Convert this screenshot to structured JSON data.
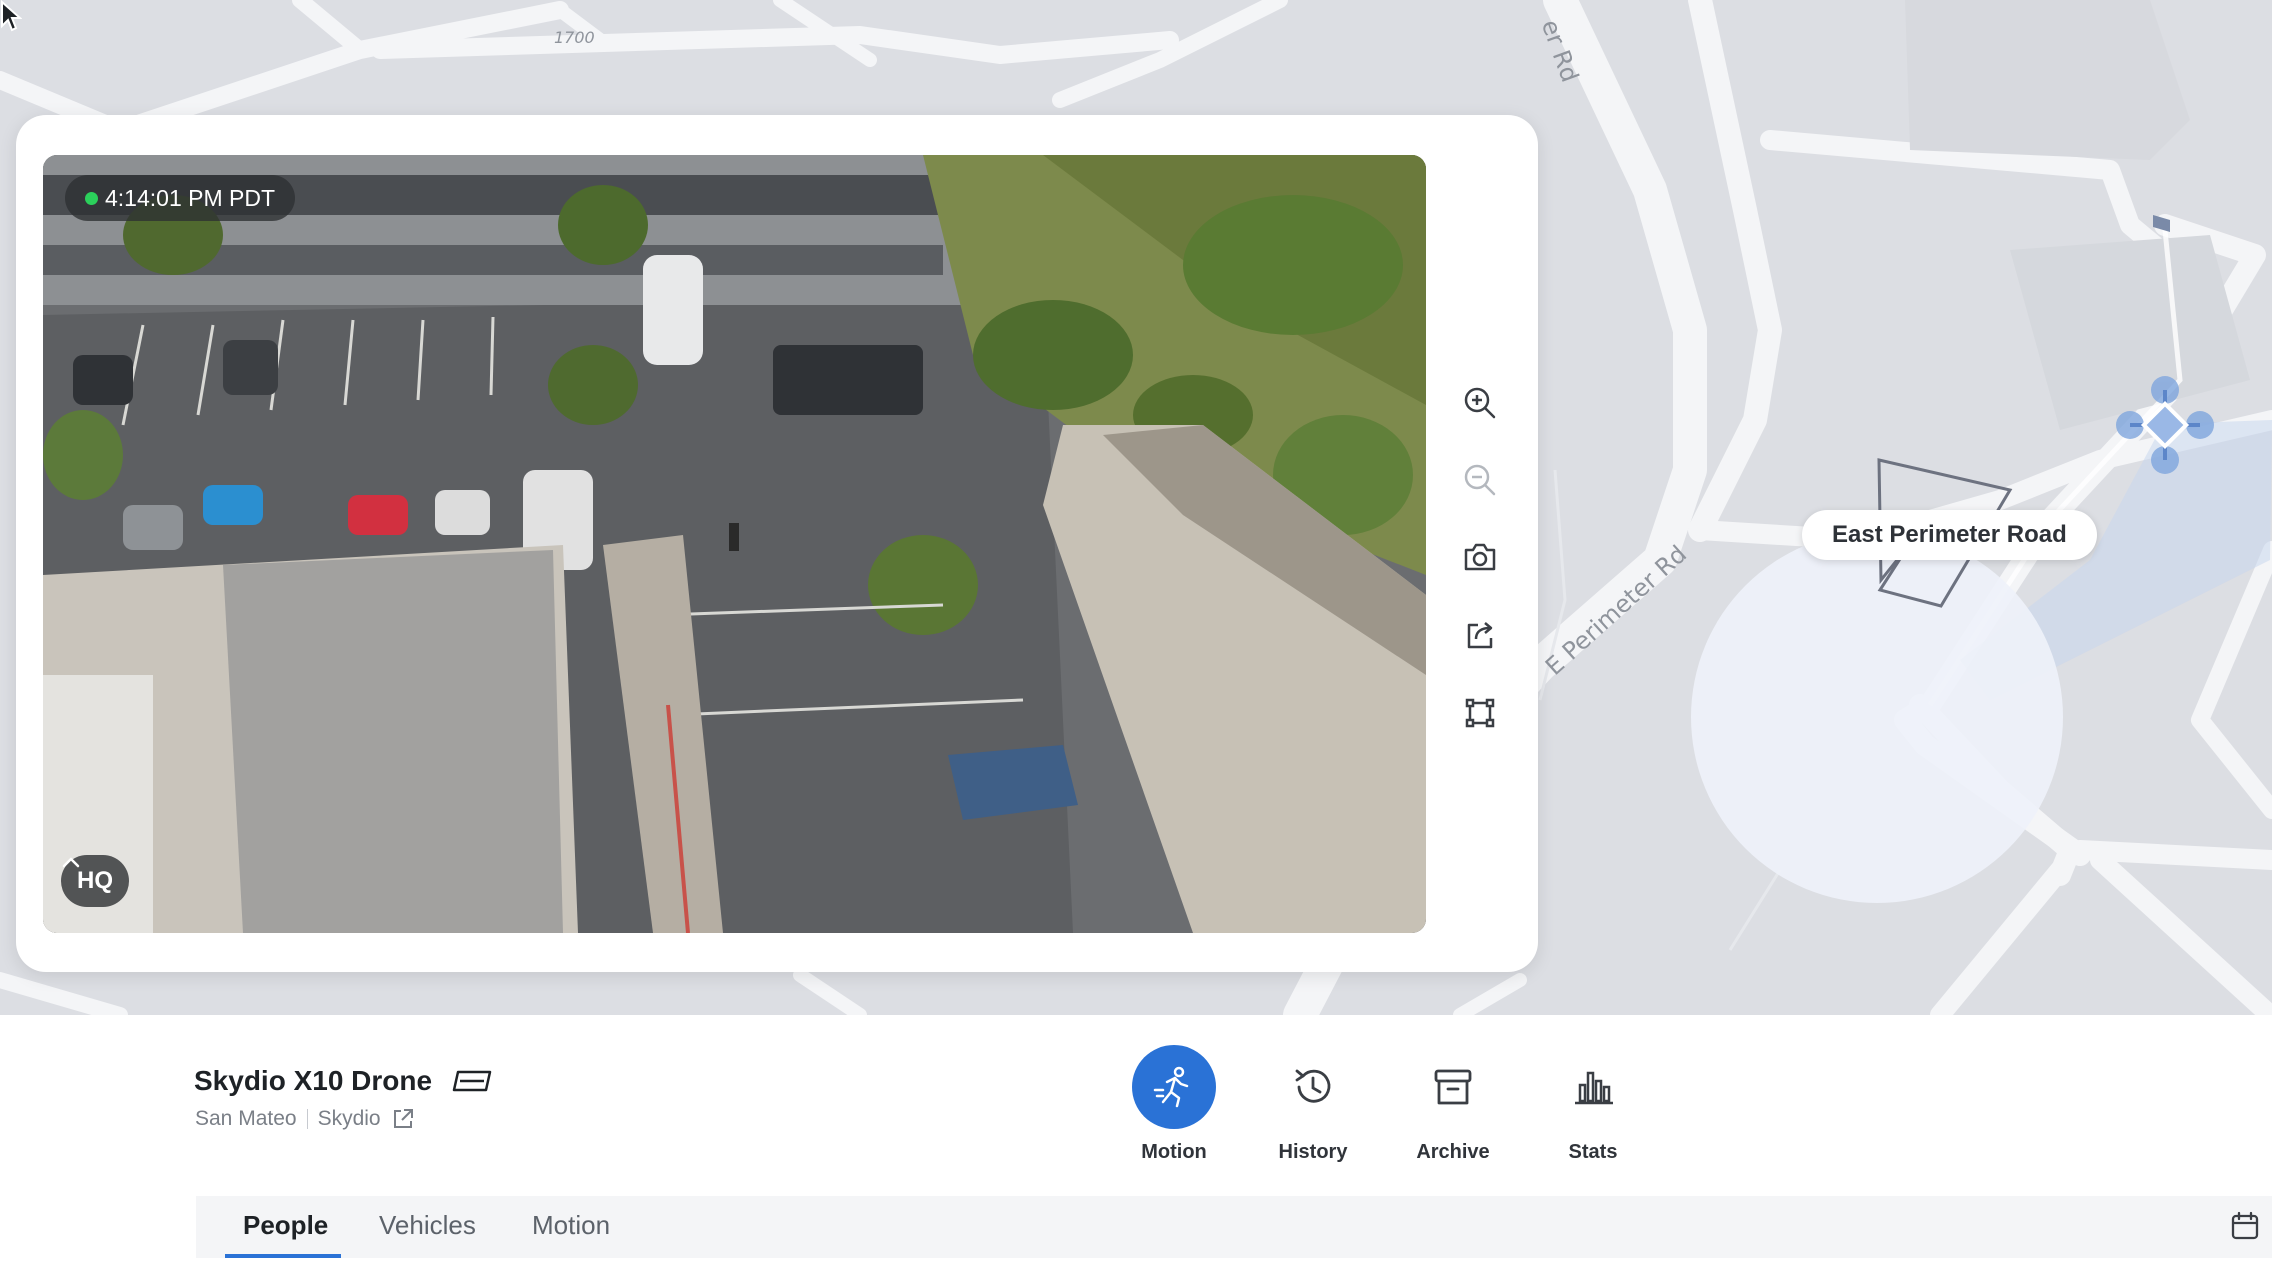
{
  "map": {
    "location_tag": "East Perimeter Road",
    "street_labels": [
      "1700",
      "er Rd",
      "E Perimeter Rd"
    ]
  },
  "video": {
    "timestamp": "4:14:01 PM PDT",
    "quality": "HQ",
    "tools": [
      {
        "icon": "zoom-in-icon",
        "enabled": true
      },
      {
        "icon": "zoom-out-icon",
        "enabled": false
      },
      {
        "icon": "camera-icon",
        "enabled": true
      },
      {
        "icon": "share-icon",
        "enabled": true
      },
      {
        "icon": "fit-frame-icon",
        "enabled": true
      }
    ]
  },
  "device": {
    "name": "Skydio X10 Drone",
    "location": "San Mateo",
    "org": "Skydio"
  },
  "actions": [
    {
      "label": "Motion",
      "icon": "running-person-icon",
      "active": true
    },
    {
      "label": "History",
      "icon": "history-icon",
      "active": false
    },
    {
      "label": "Archive",
      "icon": "archive-icon",
      "active": false
    },
    {
      "label": "Stats",
      "icon": "bar-chart-icon",
      "active": false
    }
  ],
  "tabs": [
    {
      "label": "People",
      "active": true
    },
    {
      "label": "Vehicles",
      "active": false
    },
    {
      "label": "Motion",
      "active": false
    }
  ],
  "colors": {
    "accent": "#2a72d6",
    "live": "#2bd05b",
    "drone_blue": "#7fa6de"
  }
}
